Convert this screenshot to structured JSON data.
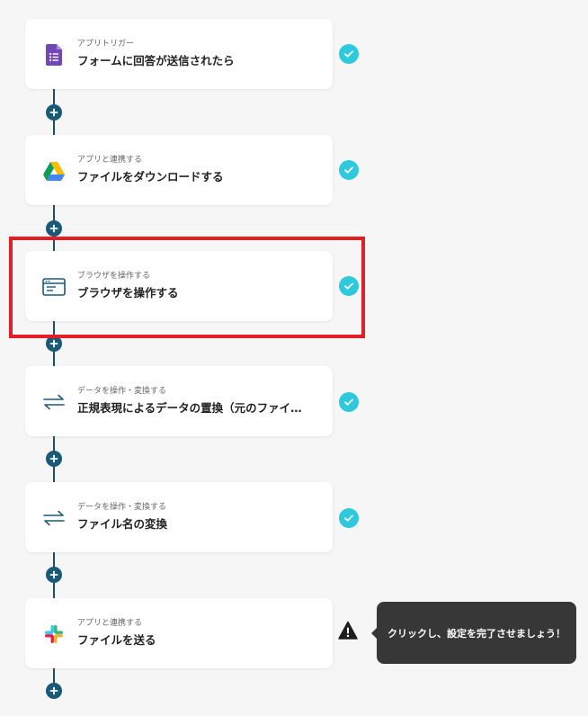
{
  "steps": [
    {
      "sub": "アプリトリガー",
      "title": "フォームに回答が送信されたら",
      "icon": "google-forms-icon",
      "status": "complete"
    },
    {
      "sub": "アプリと連携する",
      "title": "ファイルをダウンロードする",
      "icon": "google-drive-icon",
      "status": "complete"
    },
    {
      "sub": "ブラウザを操作する",
      "title": "ブラウザを操作する",
      "icon": "browser-icon",
      "status": "complete"
    },
    {
      "sub": "データを操作・変換する",
      "title": "正規表現によるデータの置換（元のファイ…",
      "icon": "swap-arrows-icon",
      "status": "complete"
    },
    {
      "sub": "データを操作・変換する",
      "title": "ファイル名の変換",
      "icon": "swap-arrows-icon",
      "status": "complete"
    },
    {
      "sub": "アプリと連携する",
      "title": "ファイルを送る",
      "icon": "slack-icon",
      "status": "warning"
    }
  ],
  "tooltip": {
    "text": "クリックし、設定を完了させましょう！"
  },
  "colors": {
    "check": "#2ec9dc",
    "plus": "#1b5a76",
    "highlight": "#e21f26",
    "tooltip_bg": "#373737"
  }
}
